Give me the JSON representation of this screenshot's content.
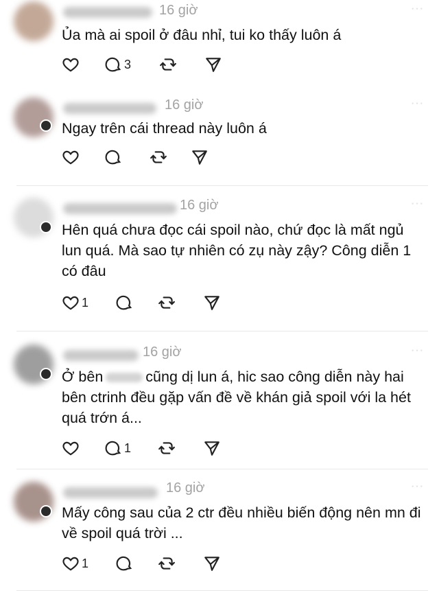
{
  "posts": [
    {
      "time": "16 giờ",
      "text": "Ủa mà ai spoil ở đâu nhỉ, tui ko thấy luôn á",
      "likes": "",
      "replies": "3",
      "avatar_color": "#b99a86"
    },
    {
      "time": "16 giờ",
      "text": "Ngay trên cái thread này luôn á",
      "likes": "",
      "replies": "",
      "avatar_color": "#a58c88"
    },
    {
      "time": "16 giờ",
      "text": "Hên quá chưa đọc cái spoil nào, chứ đọc là mất ngủ lun quá. Mà sao tự nhiên có zụ này zậy? Công diễn 1 có đâu",
      "likes": "1",
      "replies": "",
      "avatar_color": "#d6d6d6"
    },
    {
      "time": "16 giờ",
      "text_before": "Ở bên",
      "text_after": "cũng dị lun á, hic sao công diễn này hai bên ctrinh đều gặp vấn đề về khán giả spoil với la hét quá trớn á...",
      "likes": "",
      "replies": "1",
      "avatar_color": "#8e8e8e"
    },
    {
      "time": "16 giờ",
      "text": "Mấy công sau của 2 ctr đều nhiều biến động nên mn đi về spoil quá trời ...",
      "likes": "1",
      "replies": "",
      "avatar_color": "#9a7f78"
    }
  ],
  "icons": {
    "like": "heart-icon",
    "reply": "comment-icon",
    "repost": "repost-icon",
    "share": "send-icon"
  },
  "more_label": "···"
}
